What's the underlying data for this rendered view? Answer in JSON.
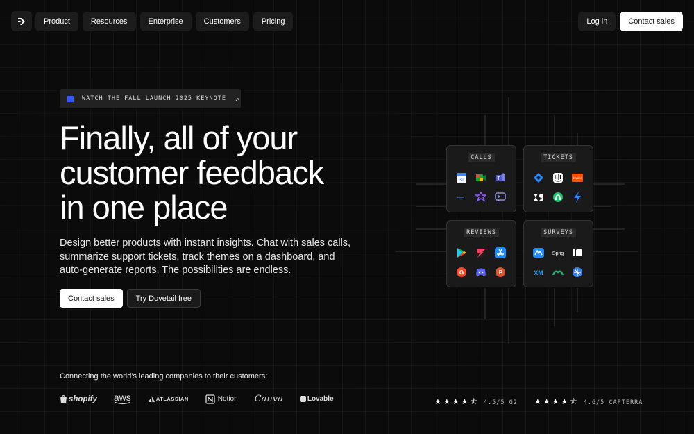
{
  "nav": {
    "links": [
      "Product",
      "Resources",
      "Enterprise",
      "Customers",
      "Pricing"
    ],
    "login": "Log in",
    "contact": "Contact sales"
  },
  "hero": {
    "keynote": "WATCH THE FALL LAUNCH 2025 KEYNOTE",
    "headline_lines": [
      "Finally, all of your",
      "customer feedback",
      "in one place"
    ],
    "subtitle": "Design better products with instant insights. Chat with sales calls, summarize support tickets, track themes on a dashboard, and auto-generate reports. The possibilities are endless.",
    "cta_primary": "Contact sales",
    "cta_secondary": "Try Dovetail free"
  },
  "cards": [
    {
      "title": "CALLS",
      "icons": [
        "google-calendar-icon",
        "google-meet-icon",
        "microsoft-teams-icon",
        "zoom-icon",
        "gong-icon",
        "chat-icon"
      ]
    },
    {
      "title": "TICKETS",
      "icons": [
        "jira-icon",
        "intercom-icon",
        "zapier-icon",
        "zendesk-icon",
        "freshdesk-icon",
        "bolt-icon"
      ]
    },
    {
      "title": "REVIEWS",
      "icons": [
        "google-play-icon",
        "asana-icon",
        "app-store-icon",
        "g2-icon",
        "discord-icon",
        "producthunt-icon"
      ]
    },
    {
      "title": "SURVEYS",
      "icons": [
        "surveymonkey-icon",
        "sprig-icon",
        "typeform-icon",
        "qualtrics-icon",
        "medallia-icon",
        "glide-icon"
      ]
    }
  ],
  "colors": {
    "accent": "#2f5bff",
    "background": "#0b0b0b"
  },
  "bottom": {
    "connect": "Connecting the world's leading companies to their customers:",
    "logos": [
      "shopify",
      "aws",
      "ATLASSIAN",
      "Notion",
      "Canva",
      "Lovable"
    ],
    "ratings": [
      {
        "score": "4.5/5 G2",
        "stars": 4.5
      },
      {
        "score": "4.6/5 CAPTERRA",
        "stars": 4.5
      }
    ]
  }
}
